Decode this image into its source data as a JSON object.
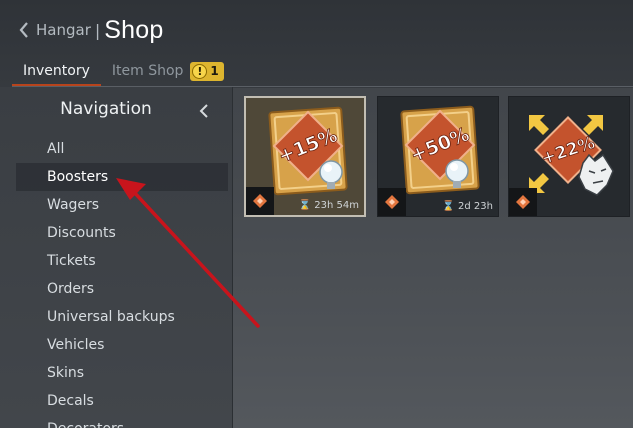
{
  "header": {
    "back_label": "Hangar",
    "separator": "|",
    "title": "Shop"
  },
  "tabs": [
    {
      "label": "Inventory",
      "active": true
    },
    {
      "label": "Item Shop",
      "active": false,
      "badge": "1",
      "badge_icon": "!"
    }
  ],
  "sidebar": {
    "title": "Navigation",
    "items": [
      {
        "label": "All"
      },
      {
        "label": "Boosters",
        "selected": true
      },
      {
        "label": "Wagers"
      },
      {
        "label": "Discounts"
      },
      {
        "label": "Tickets"
      },
      {
        "label": "Orders"
      },
      {
        "label": "Universal backups"
      },
      {
        "label": "Vehicles"
      },
      {
        "label": "Skins"
      },
      {
        "label": "Decals"
      },
      {
        "label": "Decorators"
      }
    ]
  },
  "items": [
    {
      "value": "+15%",
      "timer": "23h 54m",
      "icon": "research-bulb-icon",
      "selected": true
    },
    {
      "value": "+50%",
      "timer": "2d 23h",
      "icon": "research-bulb-icon",
      "selected": false
    },
    {
      "value": "+22%",
      "timer": "",
      "icon": "wolf-head-icon",
      "selected": false
    }
  ],
  "colors": {
    "accent_underline": "#b8441c",
    "badge": "#ddb52f",
    "booster_red": "#c4532d",
    "booster_gold": "#d7a24a",
    "annotation_arrow": "#c8141c"
  }
}
